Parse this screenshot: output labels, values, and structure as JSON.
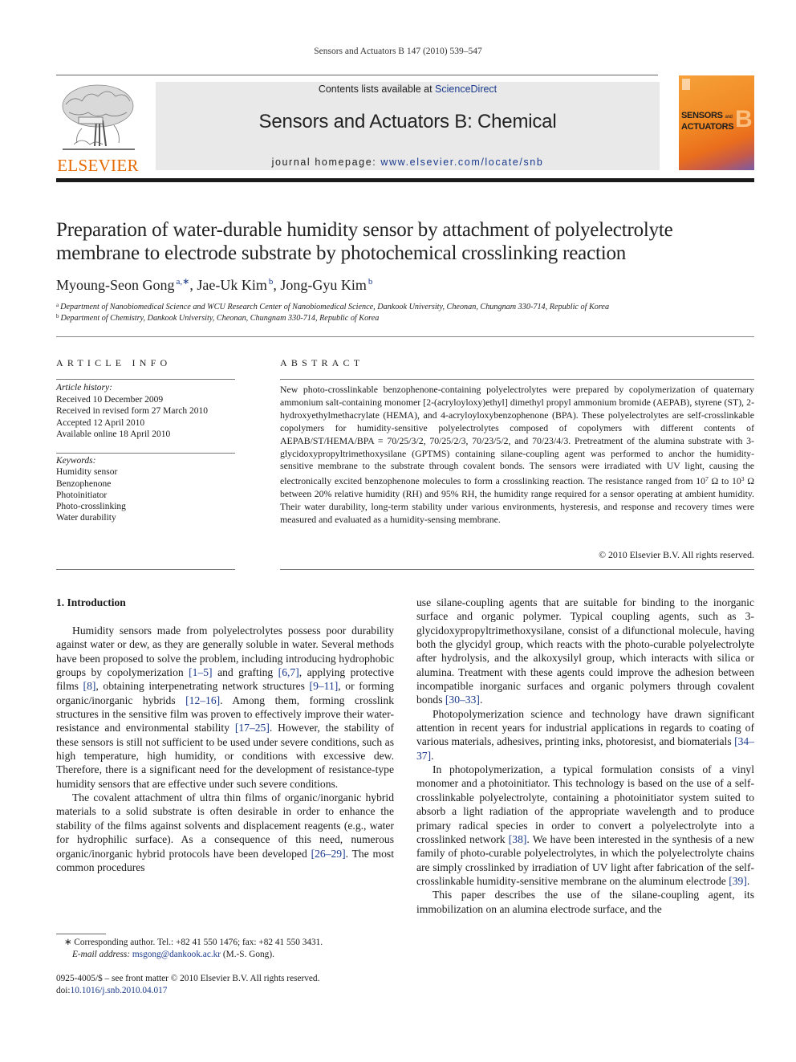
{
  "running_head": "Sensors and Actuators B 147 (2010) 539–547",
  "publisher": {
    "logo_icon": "elsevier-tree-logo",
    "wordmark": "ELSEVIER",
    "wordmark_color": "#e66a00"
  },
  "banner": {
    "contents_prefix": "Contents lists available at ",
    "contents_link": "ScienceDirect",
    "journal_name": "Sensors and Actuators B: Chemical",
    "homepage_prefix": "journal homepage: ",
    "homepage_link": "www.elsevier.com/locate/snb",
    "background": "#e9e9e9",
    "link_color": "#1a3a8c"
  },
  "cover": {
    "line1": "SENSORS",
    "line1_small": "and",
    "line2": "ACTUATORS",
    "letter": "B",
    "accent": "#f18a25"
  },
  "article": {
    "title": "Preparation of water-durable humidity sensor by attachment of polyelectrolyte membrane to electrode substrate by photochemical crosslinking reaction",
    "authors": [
      {
        "name": "Myoung-Seon Gong",
        "sup": "a,∗",
        "sep": ", "
      },
      {
        "name": "Jae-Uk Kim",
        "sup": "b",
        "sep": ", "
      },
      {
        "name": "Jong-Gyu Kim",
        "sup": "b",
        "sep": ""
      }
    ],
    "affiliations": [
      {
        "mark": "a",
        "text": "Department of Nanobiomedical Science and WCU Research Center of Nanobiomedical Science, Dankook University, Cheonan, Chungnam 330-714, Republic of Korea"
      },
      {
        "mark": "b",
        "text": "Department of Chemistry, Dankook University, Cheonan, Chungnam 330-714, Republic of Korea"
      }
    ]
  },
  "article_info": {
    "heading": "ARTICLE INFO",
    "history_label": "Article history:",
    "history": [
      "Received 10 December 2009",
      "Received in revised form 27 March 2010",
      "Accepted 12 April 2010",
      "Available online 18 April 2010"
    ],
    "keywords_label": "Keywords:",
    "keywords": [
      "Humidity sensor",
      "Benzophenone",
      "Photoinitiator",
      "Photo-crosslinking",
      "Water durability"
    ]
  },
  "abstract": {
    "heading": "ABSTRACT",
    "part1": "New photo-crosslinkable benzophenone-containing polyelectrolytes were prepared by copolymerization of quaternary ammonium salt-containing monomer [2-(acryloyloxy)ethyl] dimethyl propyl ammonium bromide (AEPAB), styrene (ST), 2-hydroxyethylmethacrylate (HEMA), and 4-acryloyloxybenzophenone (BPA). These polyelectrolytes are self-crosslinkable copolymers for humidity-sensitive polyelectrolytes composed of copolymers with different contents of AEPAB/ST/HEMA/BPA = 70/25/3/2, 70/25/2/3, 70/23/5/2, and 70/23/4/3. Pretreatment of the alumina substrate with 3-glycidoxypropyltrimethoxysilane (GPTMS) containing silane-coupling agent was performed to anchor the humidity-sensitive membrane to the substrate through covalent bonds. The sensors were irradiated with UV light, causing the electronically excited benzophenone molecules to form a crosslinking reaction. The resistance ranged from 10",
    "exp1": "7",
    "part2": " Ω to 10",
    "exp2": "3",
    "part3": " Ω between 20% relative humidity (RH) and 95% RH, the humidity range required for a sensor operating at ambient humidity. Their water durability, long-term stability under various environments, hysteresis, and response and recovery times were measured and evaluated as a humidity-sensing membrane.",
    "copyright": "© 2010 Elsevier B.V. All rights reserved."
  },
  "body": {
    "section_heading": "1.  Introduction",
    "left_paragraphs": [
      [
        {
          "t": "Humidity sensors made from polyelectrolytes possess poor durability against water or dew, as they are generally soluble in water. Several methods have been proposed to solve the problem, including introducing hydrophobic groups by copolymerization "
        },
        {
          "ref": "[1–5]"
        },
        {
          "t": " and grafting "
        },
        {
          "ref": "[6,7]"
        },
        {
          "t": ", applying protective films "
        },
        {
          "ref": "[8]"
        },
        {
          "t": ", obtaining interpenetrating network structures "
        },
        {
          "ref": "[9–11]"
        },
        {
          "t": ", or forming organic/inorganic hybrids "
        },
        {
          "ref": "[12–16]"
        },
        {
          "t": ". Among them, forming crosslink structures in the sensitive film was proven to effectively improve their water-resistance and environmental stability "
        },
        {
          "ref": "[17–25]"
        },
        {
          "t": ". However, the stability of these sensors is still not sufficient to be used under severe conditions, such as high temperature, high humidity, or conditions with excessive dew. Therefore, there is a significant need for the development of resistance-type humidity sensors that are effective under such severe conditions."
        }
      ],
      [
        {
          "t": "The covalent attachment of ultra thin films of organic/inorganic hybrid materials to a solid substrate is often desirable in order to enhance the stability of the films against solvents and displacement reagents (e.g., water for hydrophilic surface). As a consequence of this need, numerous organic/inorganic hybrid protocols have been developed "
        },
        {
          "ref": "[26–29]"
        },
        {
          "t": ". The most common procedures"
        }
      ]
    ],
    "right_paragraphs": [
      [
        {
          "t": "use silane-coupling agents that are suitable for binding to the inorganic surface and organic polymer. Typical coupling agents, such as 3-glycidoxypropyltrimethoxysilane, consist of a difunctional molecule, having both the glycidyl group, which reacts with the photo-curable polyelectrolyte after hydrolysis, and the alkoxysilyl group, which interacts with silica or alumina. Treatment with these agents could improve the adhesion between incompatible inorganic surfaces and organic polymers through covalent bonds "
        },
        {
          "ref": "[30–33]"
        },
        {
          "t": "."
        }
      ],
      [
        {
          "t": "Photopolymerization science and technology have drawn significant attention in recent years for industrial applications in regards to coating of various materials, adhesives, printing inks, photoresist, and biomaterials "
        },
        {
          "ref": "[34–37]"
        },
        {
          "t": "."
        }
      ],
      [
        {
          "t": "In photopolymerization, a typical formulation consists of a vinyl monomer and a photoinitiator. This technology is based on the use of a self-crosslinkable polyelectrolyte, containing a photoinitiator system suited to absorb a light radiation of the appropriate wavelength and to produce primary radical species in order to convert a polyelectrolyte into a crosslinked network "
        },
        {
          "ref": "[38]"
        },
        {
          "t": ". We have been interested in the synthesis of a new family of photo-curable polyelectrolytes, in which the polyelectrolyte chains are simply crosslinked by irradiation of UV light after fabrication of the self-crosslinkable humidity-sensitive membrane on the aluminum electrode "
        },
        {
          "ref": "[39]"
        },
        {
          "t": "."
        }
      ],
      [
        {
          "t": "This paper describes the use of the silane-coupling agent, its immobilization on an alumina electrode surface, and the"
        }
      ]
    ]
  },
  "footnote": {
    "mark": "∗",
    "text": "Corresponding author. Tel.: +82 41 550 1476; fax: +82 41 550 3431.",
    "email_label": "E-mail address:",
    "email": "msgong@dankook.ac.kr",
    "email_suffix": " (M.-S. Gong)."
  },
  "front_matter": {
    "issn_line": "0925-4005/$ – see front matter © 2010 Elsevier B.V. All rights reserved.",
    "doi_prefix": "doi:",
    "doi": "10.1016/j.snb.2010.04.017"
  }
}
